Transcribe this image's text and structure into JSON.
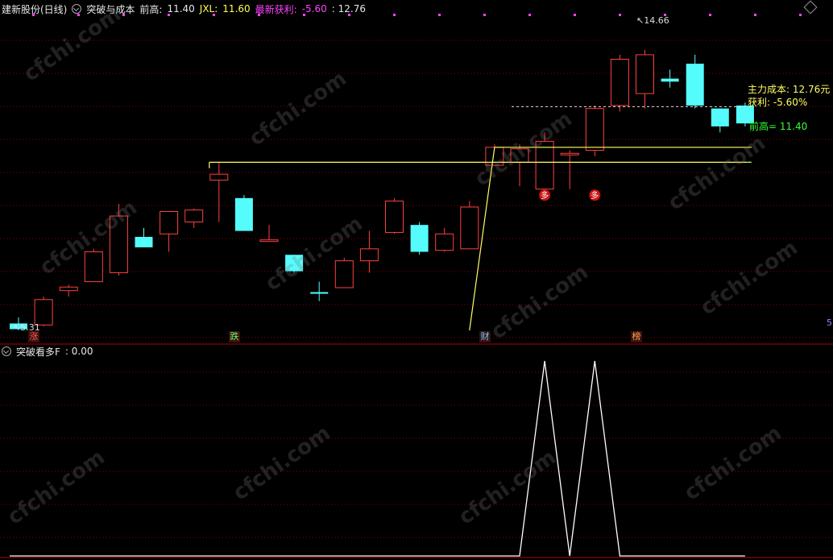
{
  "header": {
    "stock_name": "建新股份(日线)",
    "indicator_name": "突破与成本",
    "prev_high_label": "前高:",
    "prev_high_value": "11.40",
    "jxl_label": "JXL:",
    "jxl_value": "11.60",
    "latest_profit_label": "最新获利:",
    "latest_profit_value": "-5.60",
    "extra_value": ": 12.76"
  },
  "subpanel_header": {
    "indicator_name": "突破看多F",
    "value": ": 0.00"
  },
  "annotations": {
    "high_marker": "14.66",
    "low_marker": "5.31",
    "cost_label": "主力成本: 12.76元",
    "profit_label": "获利: -5.60%",
    "prev_high_line_label": "前高= 11.40",
    "right_edge_label": "5"
  },
  "signal_tags": [
    {
      "text": "涨",
      "color": "#ff5555"
    },
    {
      "text": "跌",
      "color": "#66ff66"
    },
    {
      "text": "财",
      "color": "#66ccff"
    },
    {
      "text": "榜",
      "color": "#ffaa44"
    }
  ],
  "buy_markers": [
    {
      "text": "多"
    },
    {
      "text": "多"
    }
  ],
  "watermark": "cfchi.com",
  "colors": {
    "up": "#ff4040",
    "down": "#54fcfc",
    "grid": "#8b0000",
    "yellow_line": "#ffff66",
    "green_label": "#33ff33",
    "dot": "#ff44ff"
  },
  "chart_data": {
    "type": "candlestick",
    "ohlc": [
      {
        "o": 5.5,
        "h": 5.7,
        "l": 5.31,
        "c": 5.31
      },
      {
        "o": 5.45,
        "h": 6.4,
        "l": 5.4,
        "c": 6.3
      },
      {
        "o": 6.6,
        "h": 6.8,
        "l": 6.4,
        "c": 6.72
      },
      {
        "o": 6.9,
        "h": 8.0,
        "l": 6.9,
        "c": 7.9
      },
      {
        "o": 7.2,
        "h": 9.5,
        "l": 7.1,
        "c": 9.1
      },
      {
        "o": 8.4,
        "h": 8.7,
        "l": 8.1,
        "c": 8.05
      },
      {
        "o": 8.5,
        "h": 9.2,
        "l": 7.9,
        "c": 9.25
      },
      {
        "o": 8.9,
        "h": 9.35,
        "l": 8.7,
        "c": 9.3
      },
      {
        "o": 10.3,
        "h": 10.9,
        "l": 8.9,
        "c": 10.5
      },
      {
        "o": 9.7,
        "h": 9.8,
        "l": 8.6,
        "c": 8.6
      },
      {
        "o": 8.3,
        "h": 8.8,
        "l": 8.3,
        "c": 8.3
      },
      {
        "o": 7.8,
        "h": 7.4,
        "l": 7.2,
        "c": 7.25
      },
      {
        "o": 6.55,
        "h": 6.9,
        "l": 6.25,
        "c": 6.5
      },
      {
        "o": 6.7,
        "h": 7.7,
        "l": 6.7,
        "c": 7.6
      },
      {
        "o": 7.6,
        "h": 8.6,
        "l": 7.2,
        "c": 8.0
      },
      {
        "o": 8.55,
        "h": 9.7,
        "l": 8.5,
        "c": 9.6
      },
      {
        "o": 8.8,
        "h": 8.9,
        "l": 7.8,
        "c": 7.9
      },
      {
        "o": 7.95,
        "h": 8.7,
        "l": 7.9,
        "c": 8.5
      },
      {
        "o": 8.0,
        "h": 9.6,
        "l": 8.0,
        "c": 9.4
      },
      {
        "o": 10.8,
        "h": 11.5,
        "l": 10.8,
        "c": 11.4
      },
      {
        "o": 10.9,
        "h": 11.5,
        "l": 10.1,
        "c": 11.35
      },
      {
        "o": 10.0,
        "h": 11.9,
        "l": 9.8,
        "c": 11.6
      },
      {
        "o": 11.2,
        "h": 11.3,
        "l": 10.0,
        "c": 11.2
      },
      {
        "o": 11.3,
        "h": 12.8,
        "l": 11.1,
        "c": 12.7
      },
      {
        "o": 12.8,
        "h": 14.5,
        "l": 12.6,
        "c": 14.35
      },
      {
        "o": 13.2,
        "h": 14.66,
        "l": 12.7,
        "c": 14.5
      },
      {
        "o": 13.7,
        "h": 14.0,
        "l": 13.4,
        "c": 13.6
      },
      {
        "o": 14.2,
        "h": 14.5,
        "l": 12.7,
        "c": 12.8
      },
      {
        "o": 12.7,
        "h": 12.7,
        "l": 11.9,
        "c": 12.1
      },
      {
        "o": 12.8,
        "h": 12.9,
        "l": 12.1,
        "c": 12.2
      }
    ],
    "main_cost": 12.76,
    "prev_high": 11.4,
    "sub_indicator": {
      "name": "突破看多F",
      "values": [
        0,
        0,
        0,
        0,
        0,
        0,
        0,
        0,
        0,
        0,
        0,
        0,
        0,
        0,
        0,
        0,
        0,
        0,
        0,
        0,
        0,
        1,
        0,
        1,
        0,
        0,
        0,
        0,
        0,
        0
      ]
    }
  }
}
